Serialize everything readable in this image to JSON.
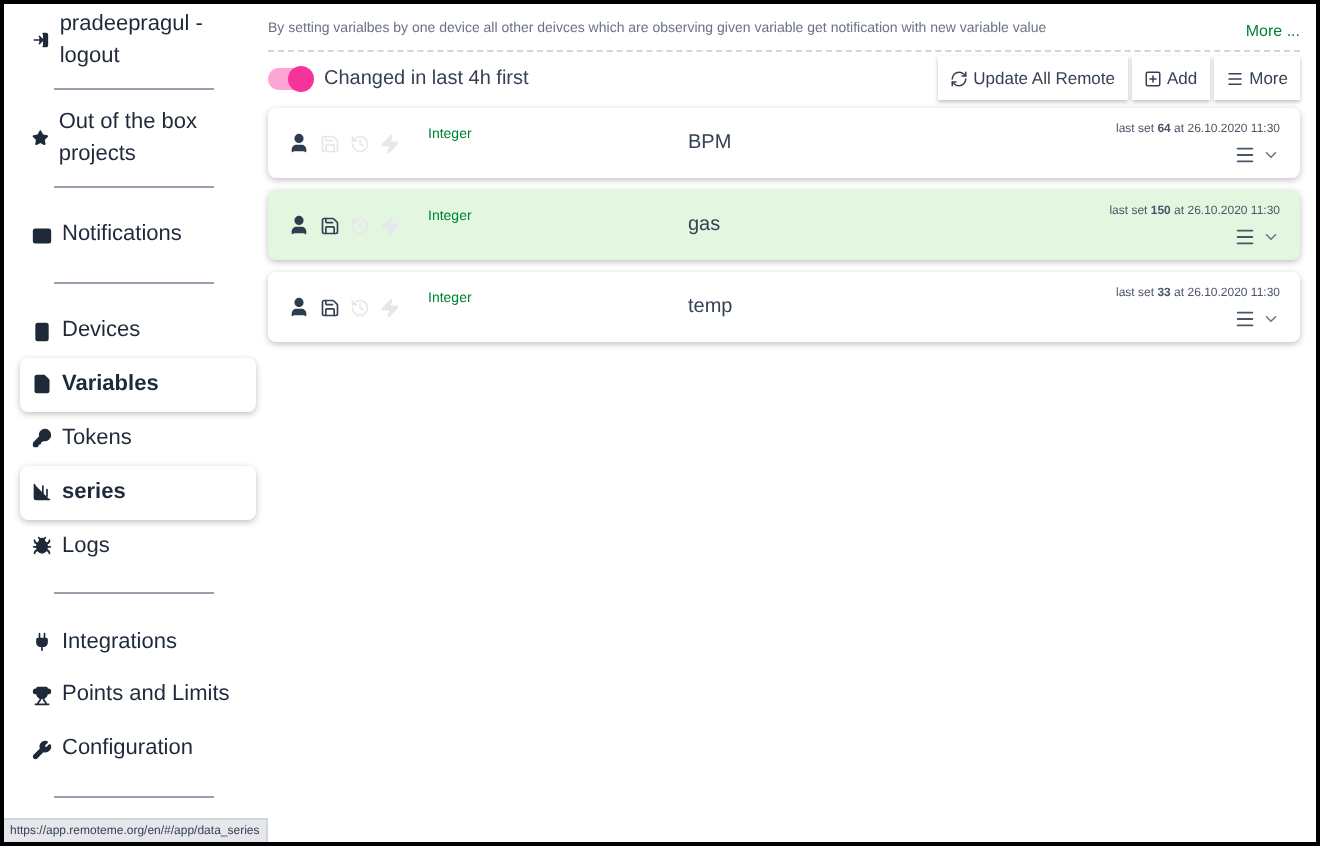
{
  "sidebar": {
    "items": [
      {
        "kind": "link",
        "label": "pradeepragul - logout",
        "selected": false
      },
      {
        "kind": "divider"
      },
      {
        "kind": "link",
        "label": "Out of the box projects",
        "selected": false
      },
      {
        "kind": "divider"
      },
      {
        "kind": "link",
        "label": "Notifications",
        "selected": false
      },
      {
        "kind": "divider"
      },
      {
        "kind": "link",
        "label": "Devices",
        "selected": false
      },
      {
        "kind": "link",
        "label": "Variables",
        "selected": true
      },
      {
        "kind": "link",
        "label": "Tokens",
        "selected": false
      },
      {
        "kind": "link",
        "label": "series",
        "selected": true
      },
      {
        "kind": "link",
        "label": "Logs",
        "selected": false
      },
      {
        "kind": "divider"
      },
      {
        "kind": "link",
        "label": "Integrations",
        "selected": false
      },
      {
        "kind": "link",
        "label": "Points and Limits",
        "selected": false
      },
      {
        "kind": "link",
        "label": "Configuration",
        "selected": false
      },
      {
        "kind": "divider"
      }
    ]
  },
  "description": "By setting varialbes by one device all other deivces which are observing given variable get notification with new variable value",
  "more_link": "More ...",
  "toggle": {
    "label": "Changed in last 4h first",
    "on": true
  },
  "toolbar": [
    "Update All Remote",
    "Add",
    "More"
  ],
  "variables": [
    {
      "type": "Integer",
      "name": "BPM",
      "last_set": "last set **64** at 26.10.2020 11:30",
      "saved": false,
      "selected": false
    },
    {
      "type": "Integer",
      "name": "gas",
      "last_set": "last set **150** at 26.10.2020 11:30",
      "saved": true,
      "selected": true
    },
    {
      "type": "Integer",
      "name": "temp",
      "last_set": "last set **33** at 26.10.2020 11:30",
      "saved": true,
      "selected": false
    }
  ],
  "status_bar": "https://app.remoteme.org/en/#/app/data_series"
}
